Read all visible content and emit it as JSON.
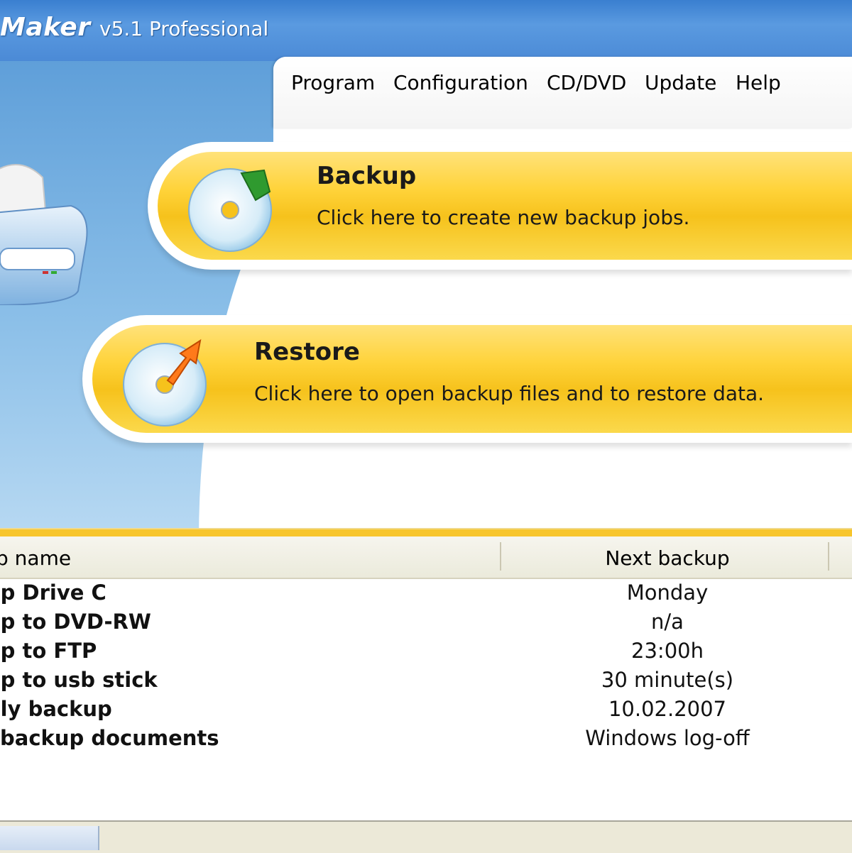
{
  "window": {
    "app_name": "Maker",
    "version": "v5.1 Professional"
  },
  "menu": {
    "items": [
      "Program",
      "Configuration",
      "CD/DVD",
      "Update",
      "Help"
    ]
  },
  "actions": {
    "backup": {
      "title": "Backup",
      "description": "Click here to create new backup jobs."
    },
    "restore": {
      "title": "Restore",
      "description": "Click here to open backup files and to restore data."
    }
  },
  "jobs": {
    "columns": [
      "p name",
      "Next backup"
    ],
    "rows": [
      {
        "name": "up Drive C",
        "next": "Monday"
      },
      {
        "name": "up to DVD-RW",
        "next": "n/a"
      },
      {
        "name": "up to FTP",
        "next": "23:00h"
      },
      {
        "name": "up to usb stick",
        "next": "30 minute(s)"
      },
      {
        "name": "nly backup",
        "next": "10.02.2007"
      },
      {
        "name": "l backup documents",
        "next": "Windows log-off"
      }
    ]
  },
  "colors": {
    "titlebar": "#4b8ad6",
    "action_yellow": "#f6c21c",
    "sidepanel_blue": "#8bbfe8"
  },
  "icons": [
    "drive-icon",
    "backup-disc-icon",
    "restore-disc-icon"
  ]
}
